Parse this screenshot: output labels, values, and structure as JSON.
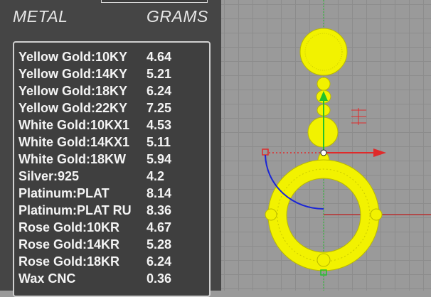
{
  "panel": {
    "headers": {
      "metal": "METAL",
      "grams": "GRAMS"
    },
    "rows": [
      {
        "metal": "Yellow Gold:10KY",
        "grams": "4.64"
      },
      {
        "metal": "Yellow Gold:14KY",
        "grams": "5.21"
      },
      {
        "metal": "Yellow Gold:18KY",
        "grams": "6.24"
      },
      {
        "metal": "Yellow Gold:22KY",
        "grams": "7.25"
      },
      {
        "metal": "White Gold:10KX1",
        "grams": "4.53"
      },
      {
        "metal": "White Gold:14KX1",
        "grams": "5.11"
      },
      {
        "metal": "White Gold:18KW",
        "grams": "5.94"
      },
      {
        "metal": "Silver:925",
        "grams": "4.2"
      },
      {
        "metal": "Platinum:PLAT",
        "grams": "8.14"
      },
      {
        "metal": "Platinum:PLAT RU",
        "grams": "8.36"
      },
      {
        "metal": "Rose Gold:10KR",
        "grams": "4.67"
      },
      {
        "metal": "Rose Gold:14KR",
        "grams": "5.28"
      },
      {
        "metal": "Rose Gold:18KR",
        "grams": "6.24"
      },
      {
        "metal": "Wax  CNC",
        "grams": "0.36"
      }
    ]
  },
  "viewport": {
    "colors": {
      "object": "#f2f200",
      "object_edge": "#b9b900",
      "x_axis": "#e02a2a",
      "y_axis": "#22c22a",
      "rotate_arc": "#1a25d6",
      "grid": "#8c8c8c"
    },
    "icons": [
      "gumball-x-arrow",
      "gumball-y-arrow",
      "rotate-arc",
      "pendant-model"
    ]
  }
}
